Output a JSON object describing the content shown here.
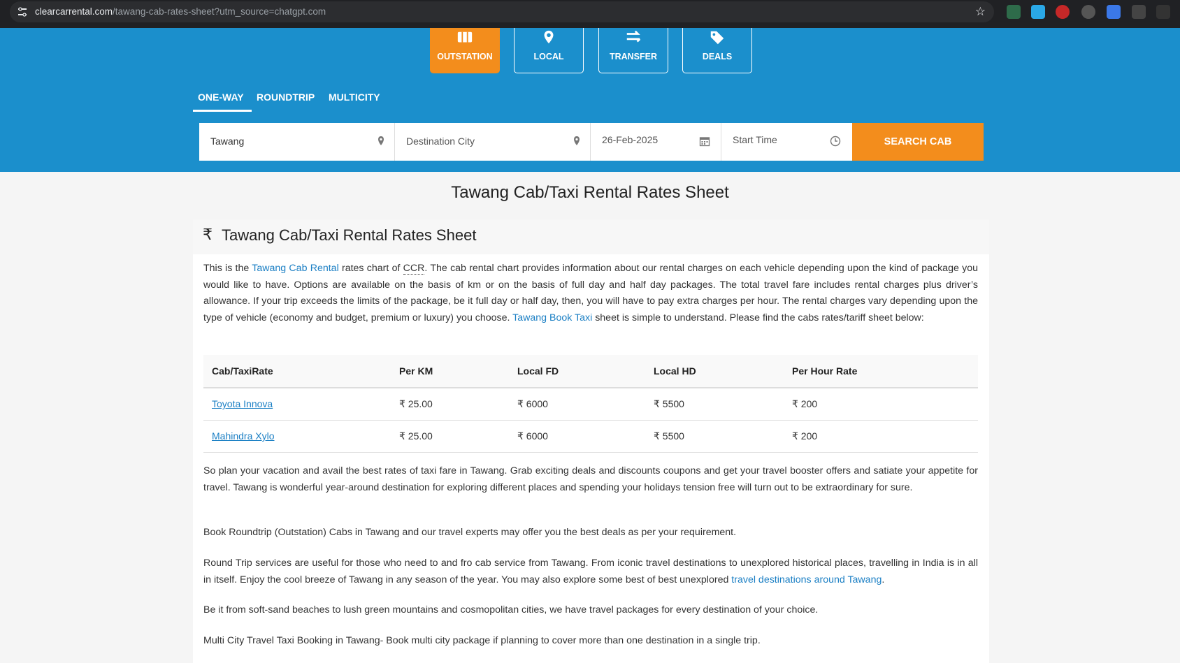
{
  "browser": {
    "url_host": "clearcarrental.com",
    "url_path": "/tawang-cab-rates-sheet?utm_source=chatgpt.com"
  },
  "services": [
    {
      "label": "OUTSTATION",
      "icon": "briefcase-icon",
      "active": true
    },
    {
      "label": "LOCAL",
      "icon": "map-pin-icon",
      "active": false
    },
    {
      "label": "TRANSFER",
      "icon": "transfer-arrows-icon",
      "active": false
    },
    {
      "label": "DEALS",
      "icon": "tag-icon",
      "active": false
    }
  ],
  "trip_tabs": [
    {
      "label": "ONE-WAY",
      "active": true
    },
    {
      "label": "ROUNDTRIP",
      "active": false
    },
    {
      "label": "MULTICITY",
      "active": false
    }
  ],
  "search": {
    "source": "Tawang",
    "destination_placeholder": "Destination City",
    "date": "26-Feb-2025",
    "time_placeholder": "Start Time",
    "button_label": "SEARCH CAB"
  },
  "page_title": "Tawang Cab/Taxi Rental Rates Sheet",
  "card": {
    "rupee_symbol": "₹",
    "heading": "Tawang Cab/Taxi Rental Rates Sheet",
    "intro": {
      "t1": "This is the ",
      "link1": "Tawang Cab Rental",
      "t2": " rates chart of ",
      "abbr": "CCR",
      "t3": ". The cab rental chart provides information about our rental charges on each vehicle depending upon the kind of package you would like to have. Options are available on the basis of km or on the basis of full day and half day packages. The total travel fare includes rental charges plus driver’s allowance. If your trip exceeds the limits of the package, be it full day or half day, then, you will have to pay extra charges per hour. The rental charges vary depending upon the type of vehicle (economy and budget, premium or luxury) you choose. ",
      "link2": "Tawang Book Taxi",
      "t4": " sheet is simple to understand. Please find the cabs rates/tariff sheet below:"
    },
    "table": {
      "headers": [
        "Cab/TaxiRate",
        "Per KM",
        "Local FD",
        "Local HD",
        "Per Hour Rate"
      ],
      "rows": [
        {
          "cab": "Toyota Innova",
          "per_km": "₹ 25.00",
          "local_fd": "₹ 6000",
          "local_hd": "₹ 5500",
          "per_hour": "₹ 200"
        },
        {
          "cab": "Mahindra Xylo",
          "per_km": "₹ 25.00",
          "local_fd": "₹ 6000",
          "local_hd": "₹ 5500",
          "per_hour": "₹ 200"
        }
      ]
    },
    "p2": "So plan your vacation and avail the best rates of taxi fare in Tawang. Grab exciting deals and discounts coupons and get your travel booster offers and satiate your appetite for travel. Tawang is wonderful year-around destination for exploring different places and spending your holidays tension free will turn out to be extraordinary for sure.",
    "p3": "Book Roundtrip (Outstation) Cabs in Tawang and our travel experts may offer you the best deals as per your requirement.",
    "p4_text": "Round Trip services are useful for those who need to and fro cab service from Tawang. From iconic travel destinations to unexplored historical places, travelling in India is in all in itself. Enjoy the cool breeze of Tawang in any season of the year. You may also explore some best of best unexplored ",
    "p4_link": "travel destinations around Tawang",
    "p4_end": ".",
    "p5": "Be it from soft-sand beaches to lush green mountains and cosmopolitan cities, we have travel packages for every destination of your choice.",
    "p6": "Multi City Travel Taxi Booking in Tawang- Book multi city package if planning to cover more than one destination in a single trip."
  },
  "colors": {
    "header_blue": "#1b8fcc",
    "accent_orange": "#f38d1c",
    "link_blue": "#1b7fc4"
  }
}
